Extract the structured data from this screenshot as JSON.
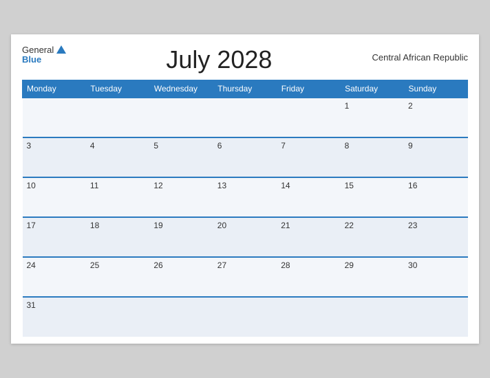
{
  "header": {
    "logo_general": "General",
    "logo_blue": "Blue",
    "title": "July 2028",
    "country": "Central African Republic"
  },
  "weekdays": [
    "Monday",
    "Tuesday",
    "Wednesday",
    "Thursday",
    "Friday",
    "Saturday",
    "Sunday"
  ],
  "weeks": [
    [
      "",
      "",
      "",
      "",
      "",
      "1",
      "2"
    ],
    [
      "3",
      "4",
      "5",
      "6",
      "7",
      "8",
      "9"
    ],
    [
      "10",
      "11",
      "12",
      "13",
      "14",
      "15",
      "16"
    ],
    [
      "17",
      "18",
      "19",
      "20",
      "21",
      "22",
      "23"
    ],
    [
      "24",
      "25",
      "26",
      "27",
      "28",
      "29",
      "30"
    ],
    [
      "31",
      "",
      "",
      "",
      "",
      "",
      ""
    ]
  ]
}
